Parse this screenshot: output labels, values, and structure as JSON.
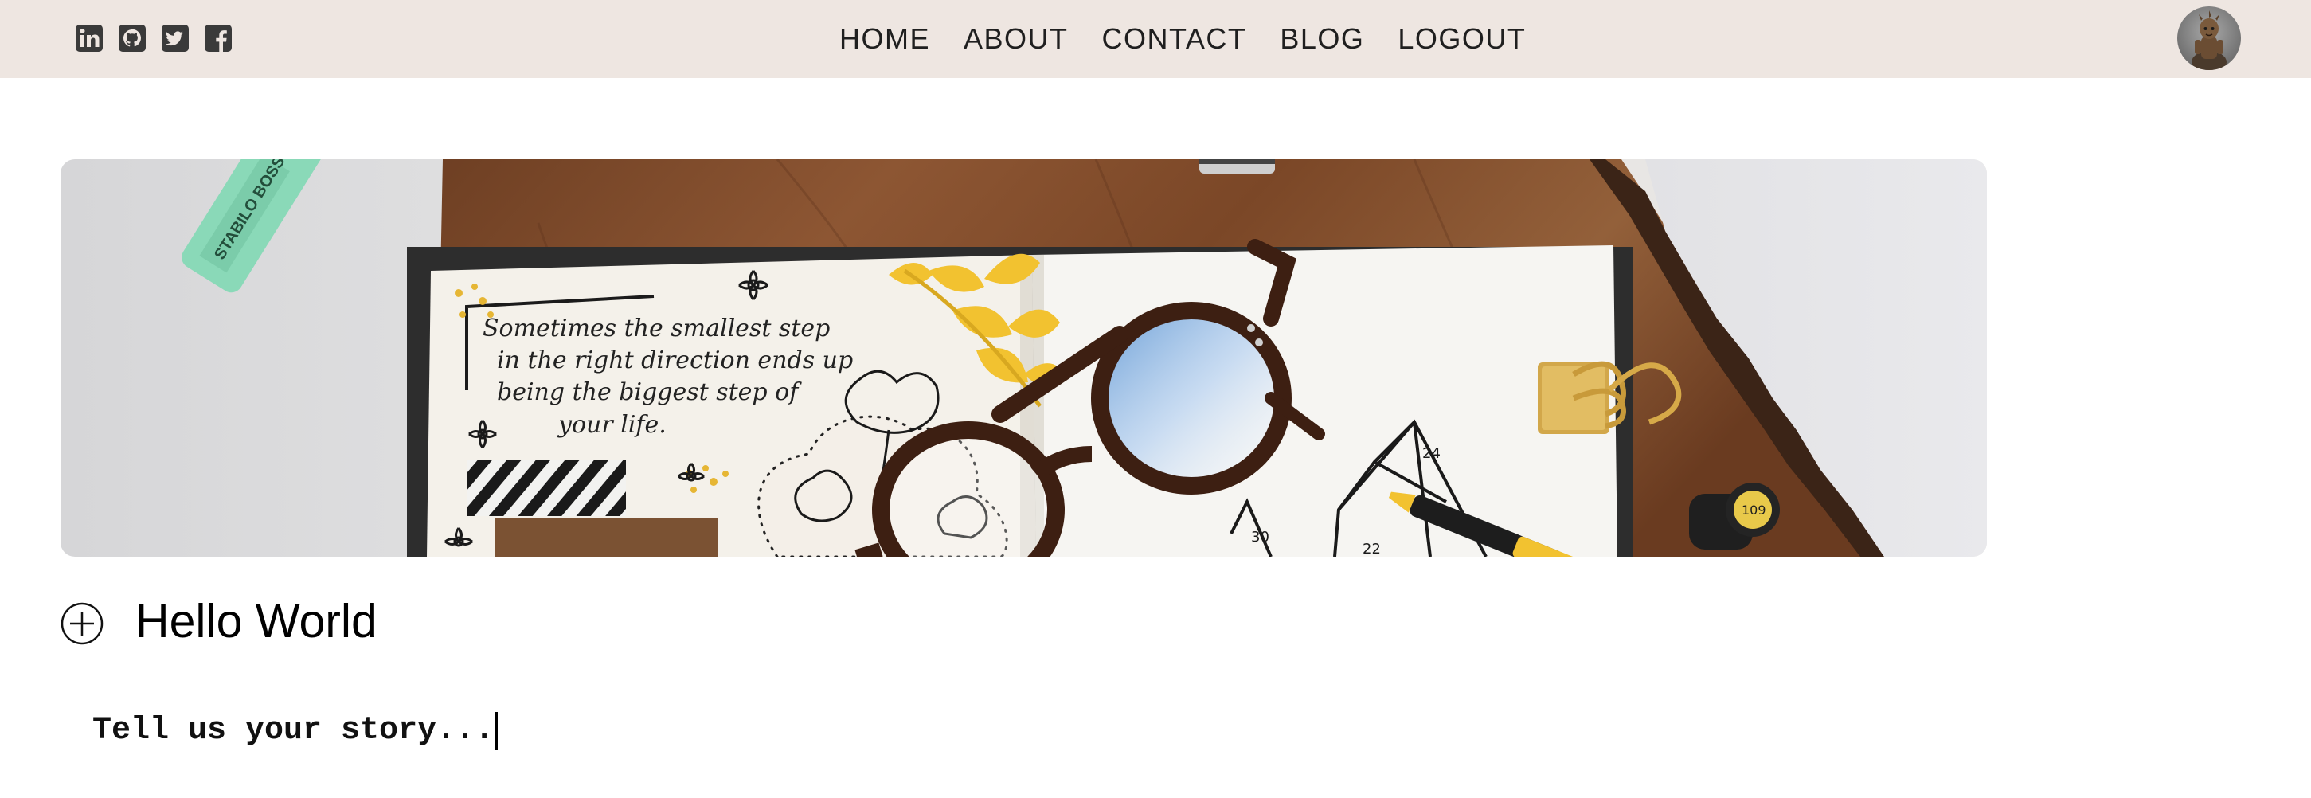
{
  "social": [
    {
      "name": "linkedin",
      "icon": "linkedin-icon"
    },
    {
      "name": "github",
      "icon": "github-icon"
    },
    {
      "name": "twitter",
      "icon": "twitter-icon"
    },
    {
      "name": "facebook",
      "icon": "facebook-icon"
    }
  ],
  "nav": {
    "links": [
      "HOME",
      "ABOUT",
      "CONTACT",
      "BLOG",
      "LOGOUT"
    ]
  },
  "avatar": {
    "icon": "user-avatar"
  },
  "hero": {
    "quote_lines": [
      "Sometimes the smallest step",
      "in the right direction ends up",
      "being the biggest step of",
      "your life."
    ],
    "highlighter_brand": "STABILO BOSS",
    "bottle_label": "109",
    "triangle_numbers": [
      "24",
      "30",
      "22"
    ]
  },
  "post": {
    "title": "Hello World",
    "add_icon": "plus-circle-icon",
    "story_placeholder": "Tell us your story..."
  },
  "colors": {
    "navbar_bg": "#eee6e1",
    "text": "#1f1f1f",
    "accent_yellow": "#f2c230"
  }
}
